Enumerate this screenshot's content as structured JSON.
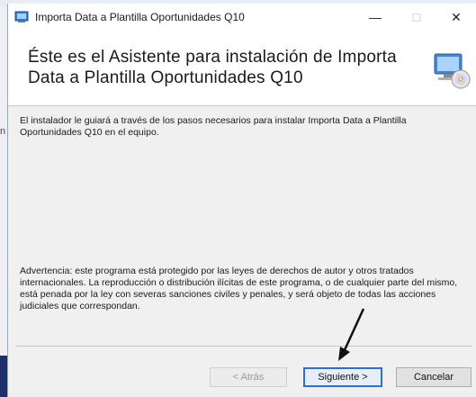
{
  "background": {
    "left_text": "n"
  },
  "window": {
    "title": "Importa Data a Plantilla Oportunidades Q10",
    "controls": {
      "minimize": "—",
      "maximize": "□",
      "close": "✕"
    }
  },
  "header": {
    "heading": "Éste es el Asistente para instalación de Importa Data a Plantilla Oportunidades Q10",
    "icon": "setup-computer-cd-icon"
  },
  "body": {
    "intro": "El instalador le guiará a través de los pasos necesarios para instalar Importa Data a Plantilla Oportunidades Q10 en el equipo.",
    "warning": "Advertencia: este programa está protegido por las leyes de derechos de autor y otros tratados internacionales. La reproducción o distribución ilícitas de este programa, o de cualquier parte del mismo, está penada por la ley con severas sanciones civiles y penales, y será objeto de todas las acciones judiciales que correspondan."
  },
  "buttons": {
    "back": "< Atrás",
    "next": "Siguiente >",
    "cancel": "Cancelar"
  },
  "colors": {
    "accent": "#2a6fd1",
    "window_bg": "#f0f0f0",
    "header_bg": "#ffffff"
  }
}
